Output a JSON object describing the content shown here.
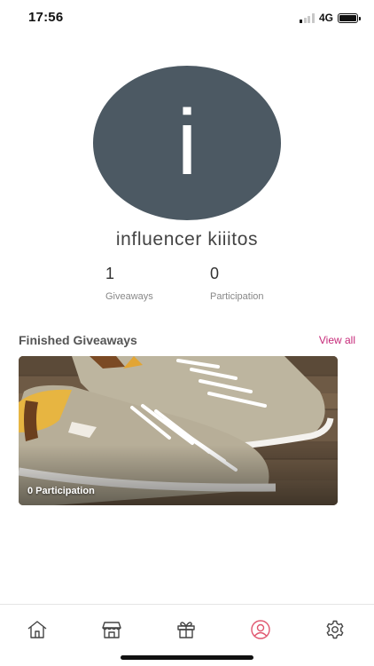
{
  "status_bar": {
    "time": "17:56",
    "network": "4G",
    "signal_bars_on": 1,
    "battery_level": 1.0
  },
  "profile": {
    "avatar_letter": "i",
    "avatar_color": "#4c5963",
    "username": "influencer kiiitos"
  },
  "stats": {
    "giveaways": {
      "value": "1",
      "label": "Giveaways"
    },
    "participation": {
      "value": "0",
      "label": "Participation"
    }
  },
  "finished_section": {
    "title": "Finished Giveaways",
    "view_all_label": "View all",
    "accent_color": "#c62a79"
  },
  "cards": [
    {
      "caption": "0 Participation",
      "image": "sneakers-photo"
    }
  ],
  "tab_bar": {
    "items": [
      {
        "icon": "home-icon",
        "active": false
      },
      {
        "icon": "store-icon",
        "active": false
      },
      {
        "icon": "gift-icon",
        "active": false
      },
      {
        "icon": "profile-icon",
        "active": true
      },
      {
        "icon": "settings-icon",
        "active": false
      }
    ],
    "active_color": "#e0566f",
    "inactive_color": "#444444"
  }
}
